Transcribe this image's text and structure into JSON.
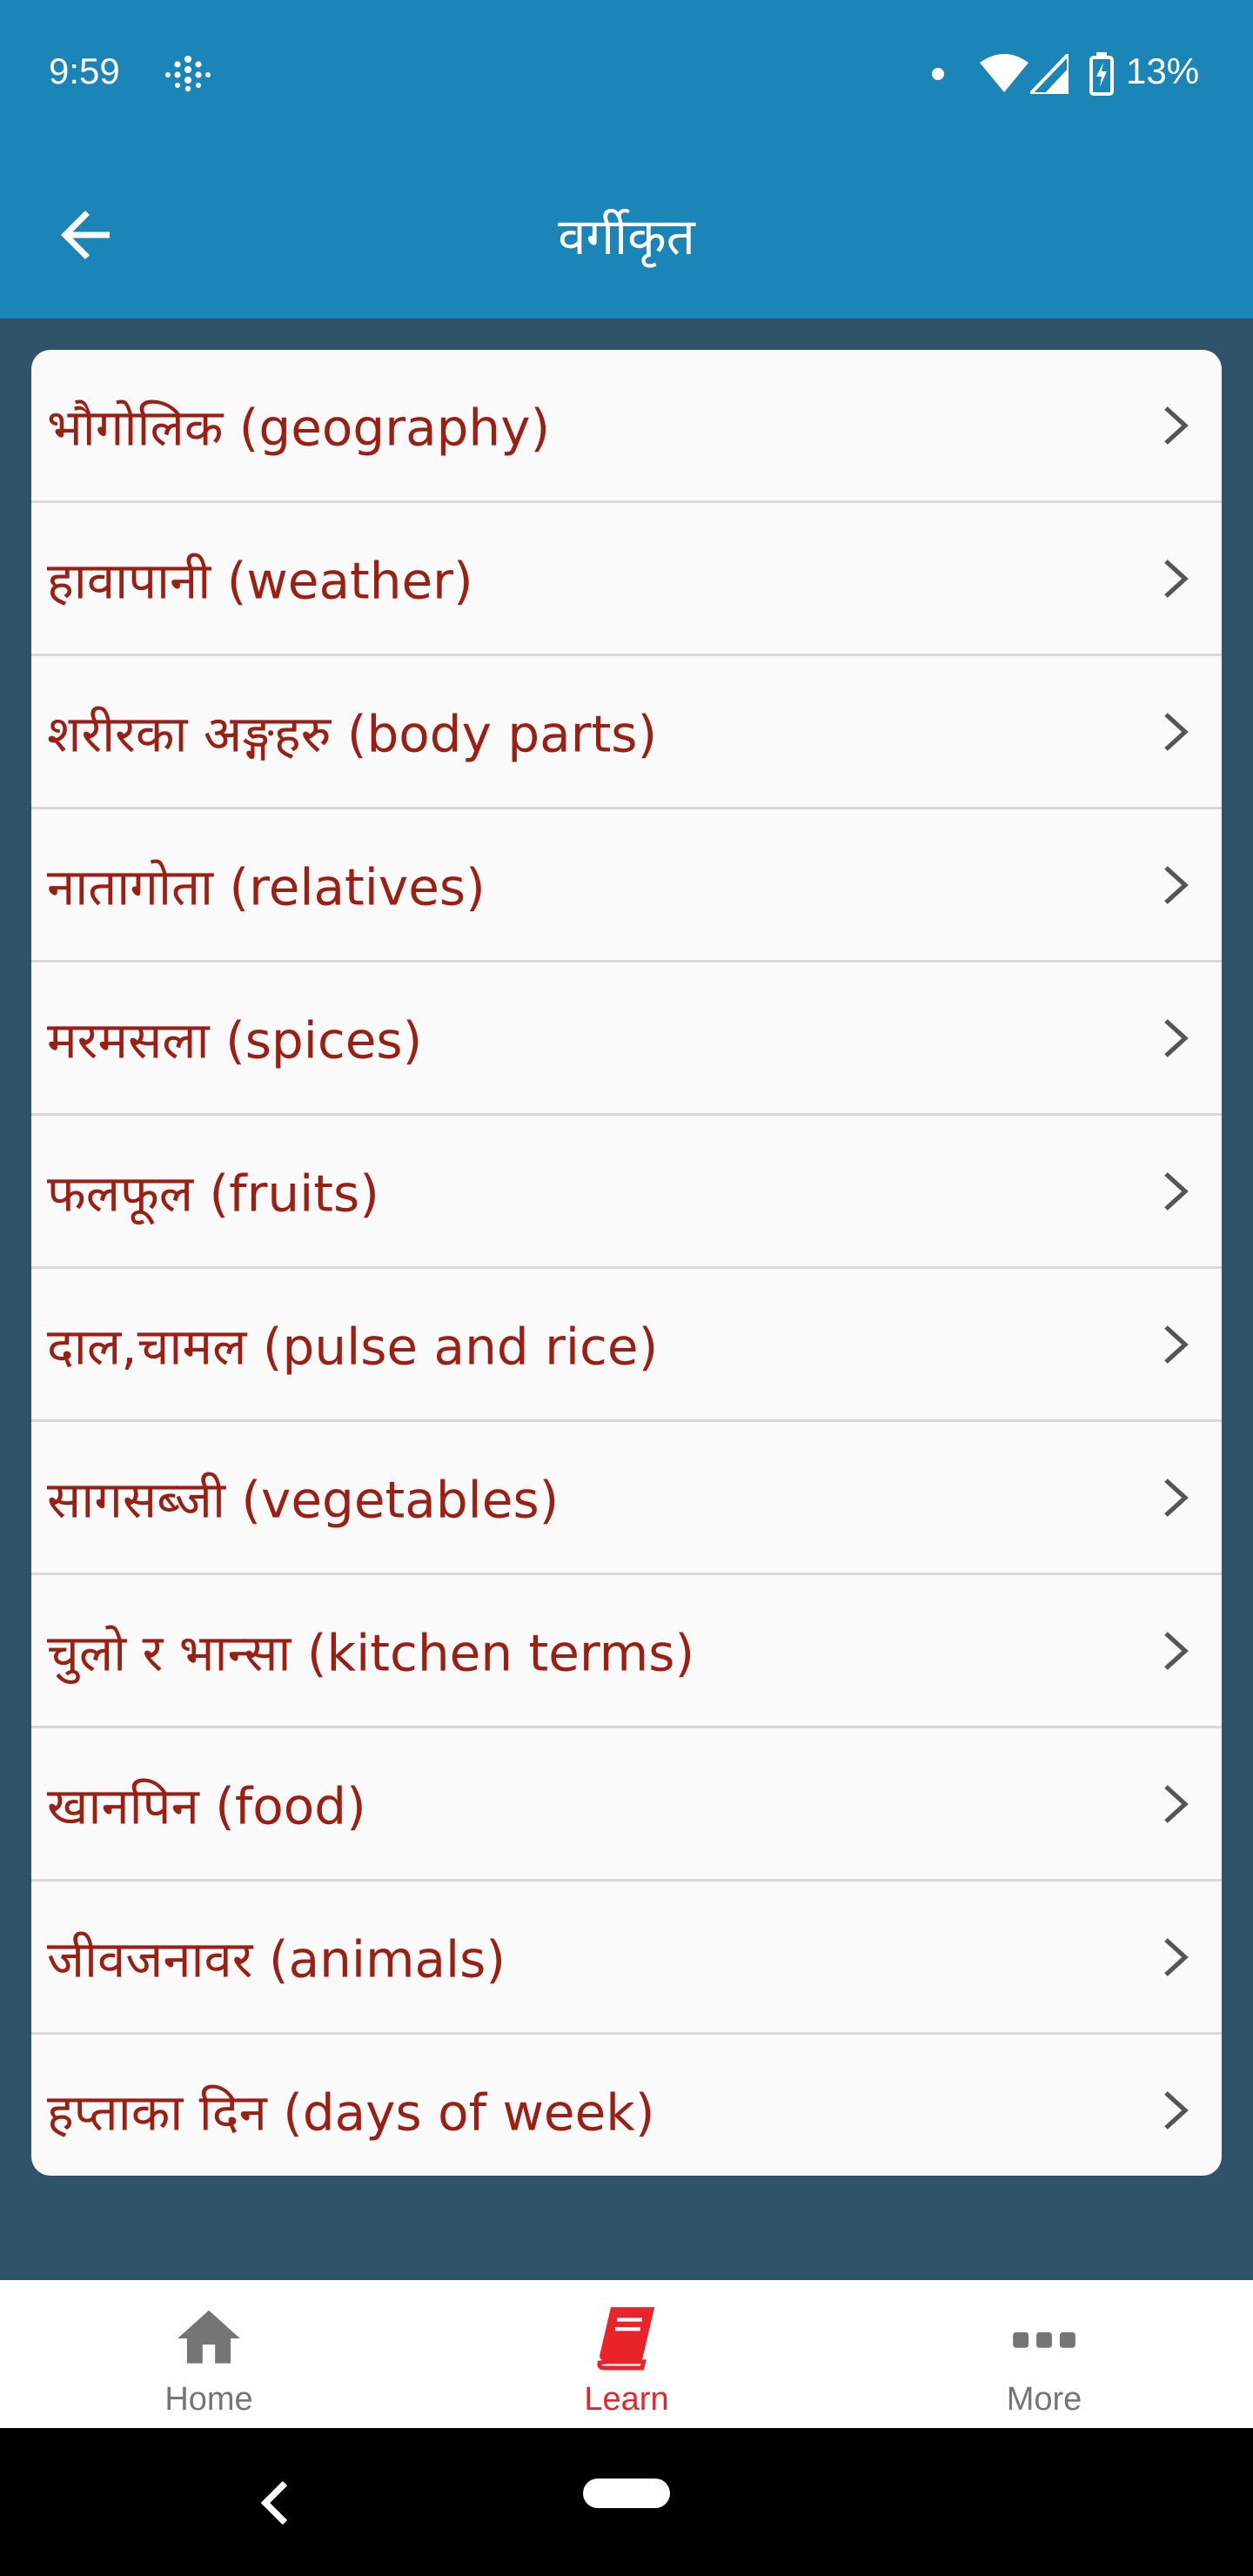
{
  "status_bar": {
    "time": "9:59",
    "battery": "13%",
    "icons": [
      "app-dots-icon",
      "notification-dot-icon",
      "wifi-icon",
      "signal-icon",
      "battery-charging-icon"
    ]
  },
  "app_bar": {
    "title": "वर्गीकृत",
    "back_icon": "arrow-left-icon"
  },
  "categories": [
    {
      "label": "भौगोलिक (geography)"
    },
    {
      "label": "हावापानी (weather)"
    },
    {
      "label": "शरीरका अङ्गहरु (body parts)"
    },
    {
      "label": "नातागोता (relatives)"
    },
    {
      "label": "मरमसला (spices)"
    },
    {
      "label": "फलफूल (fruits)"
    },
    {
      "label": "दाल,चामल (pulse and rice)"
    },
    {
      "label": "सागसब्जी (vegetables)"
    },
    {
      "label": "चुलो र भान्सा (kitchen terms)"
    },
    {
      "label": "खानपिन (food)"
    },
    {
      "label": "जीवजनावर (animals)"
    },
    {
      "label": "हप्ताका दिन (days of week)"
    }
  ],
  "bottom_nav": {
    "items": [
      {
        "label": "Home",
        "icon": "home-icon",
        "active": false
      },
      {
        "label": "Learn",
        "icon": "book-icon",
        "active": true
      },
      {
        "label": "More",
        "icon": "more-dots-icon",
        "active": false
      }
    ]
  },
  "colors": {
    "primary": "#1b85b8",
    "background": "#2f5469",
    "item_text": "#9c1f14",
    "active_nav": "#e8232a",
    "inactive_nav": "#757575"
  }
}
